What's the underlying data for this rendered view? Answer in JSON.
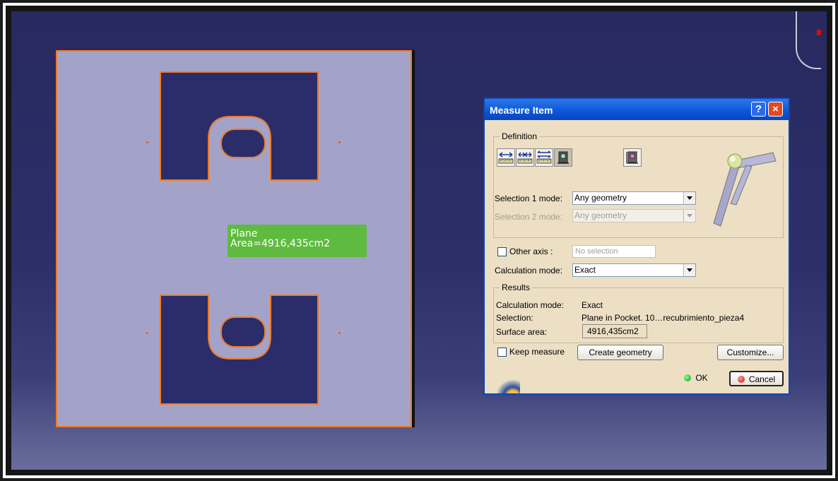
{
  "viewport": {
    "annotation": {
      "line1": "Plane",
      "line2": "Area=4916,435cm2"
    }
  },
  "dialog": {
    "title": "Measure Item",
    "help_button": "?",
    "close_button": "×",
    "definition": {
      "legend": "Definition",
      "tool_icons": [
        "measure-between-icon",
        "measure-between-chain-icon",
        "measure-between-fan-icon",
        "measure-item-icon",
        "measure-thickness-icon"
      ],
      "selection1_label": "Selection 1 mode:",
      "selection1_value": "Any geometry",
      "selection2_label": "Selection 2 mode:",
      "selection2_value": "Any geometry",
      "other_axis_label": "Other axis :",
      "other_axis_value": "No selection",
      "calc_mode_label": "Calculation mode:",
      "calc_mode_value": "Exact"
    },
    "results": {
      "legend": "Results",
      "calc_mode_label": "Calculation mode:",
      "calc_mode_value": "Exact",
      "selection_label": "Selection:",
      "selection_value": "Plane in Pocket. 10…recubrimiento_pieza4",
      "surface_label": "Surface area:",
      "surface_value": "4916,435cm2"
    },
    "keep_measure_label": "Keep measure",
    "create_geometry_label": "Create geometry",
    "customize_label": "Customize...",
    "ok_label": "OK",
    "cancel_label": "Cancel",
    "colors": {
      "title_bar": "#0a55d8",
      "dialog_bg": "#ecdfc4",
      "edge": "#f07a24",
      "plate": "#a3a3c9",
      "tag": "#5fbb3f"
    }
  }
}
